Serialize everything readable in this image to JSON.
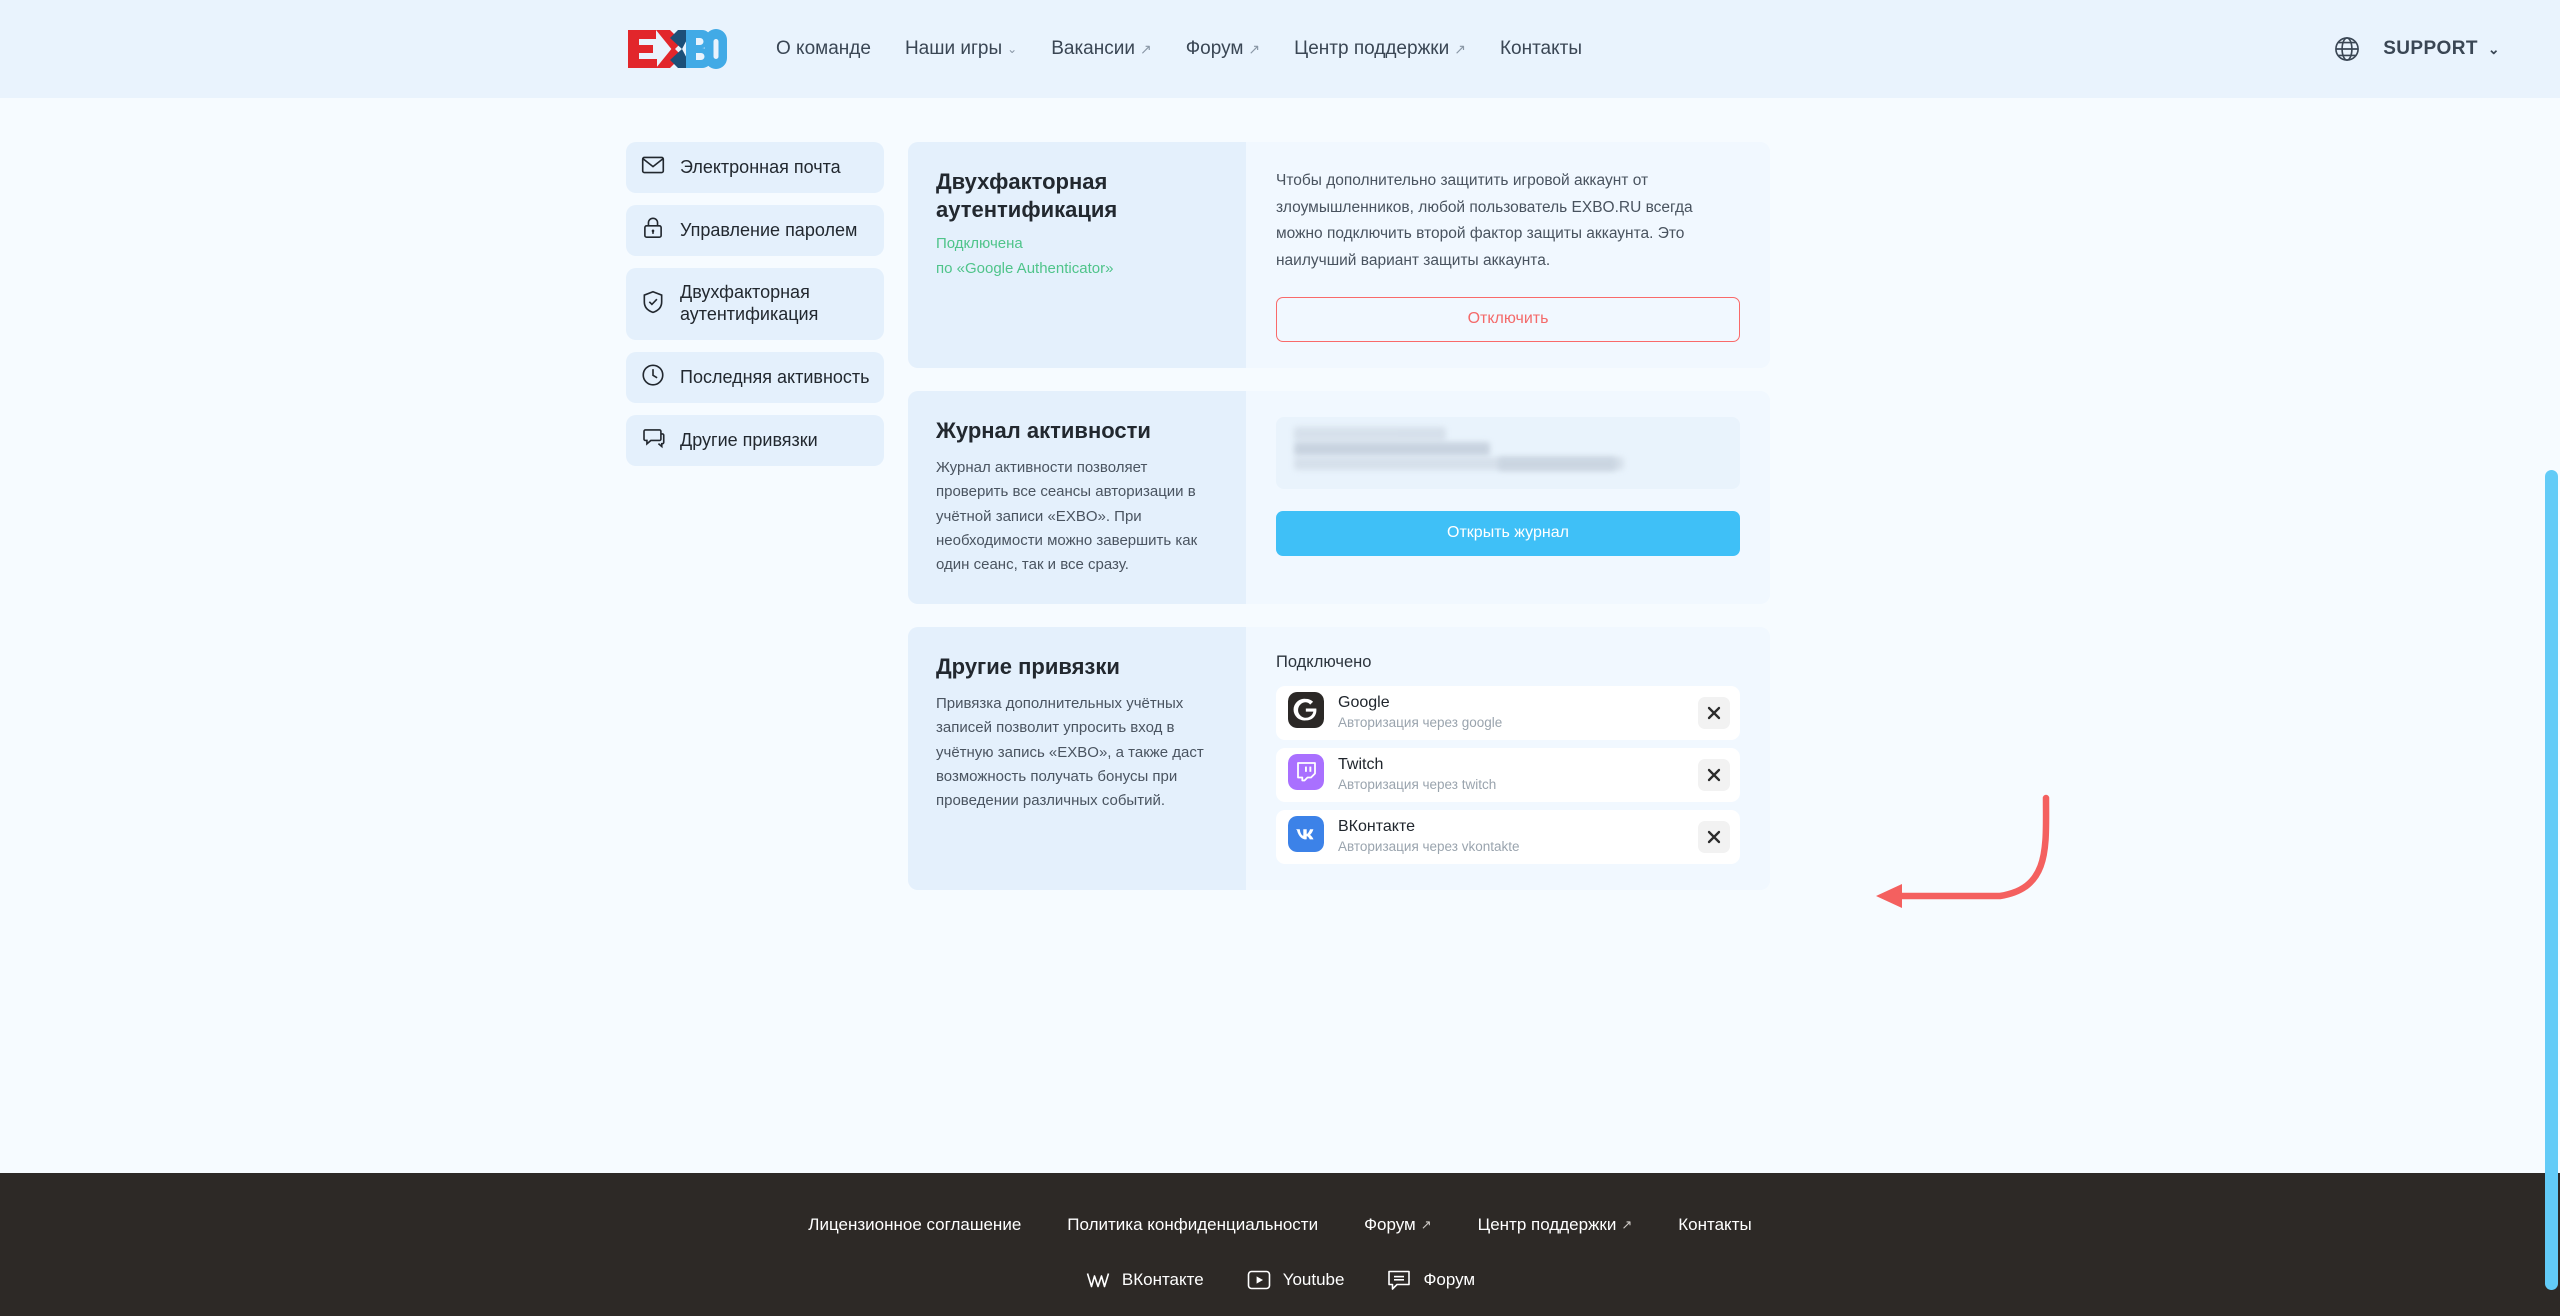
{
  "header": {
    "logo_text": "EXBO",
    "nav": [
      {
        "label": "О команде",
        "suffix": ""
      },
      {
        "label": "Наши игры",
        "suffix": "caret"
      },
      {
        "label": "Вакансии",
        "suffix": "ext"
      },
      {
        "label": "Форум",
        "suffix": "ext"
      },
      {
        "label": "Центр поддержки",
        "suffix": "ext"
      },
      {
        "label": "Контакты",
        "suffix": ""
      }
    ],
    "globe_icon": "globe-icon",
    "support_label": "SUPPORT",
    "support_caret": "⌄"
  },
  "sidebar": {
    "items": [
      {
        "label": "Электронная почта",
        "icon": "mail-icon"
      },
      {
        "label": "Управление паролем",
        "icon": "lock-icon"
      },
      {
        "label": "Двухфакторная аутентификация",
        "icon": "shield-check-icon"
      },
      {
        "label": "Последняя активность",
        "icon": "clock-icon"
      },
      {
        "label": "Другие привязки",
        "icon": "chat-icon"
      }
    ]
  },
  "cards": {
    "two_factor": {
      "title": "Двухфакторная аутентификация",
      "status": "Подключена",
      "method": "по «Google Authenticator»",
      "description": "Чтобы дополнительно защитить игровой аккаунт от злоумышленников, любой пользователь EXBO.RU всегда можно подключить второй фактор защиты аккаунта. Это наилучший вариант защиты аккаунта.",
      "button_label": "Отключить",
      "button_color": "#f46a6a"
    },
    "activity_log": {
      "title": "Журнал активности",
      "description": "Журнал активности позволяет проверить все сеансы авторизации в учётной записи «EXBO». При необходимости можно завершить как один сеанс, так и все сразу.",
      "session_preview": "(скрыто)",
      "button_label": "Открыть журнал",
      "button_color": "#3fc0f7"
    },
    "other_links": {
      "title": "Другие привязки",
      "description": "Привязка дополнительных учётных записей позволит упросить вход в учётную запись «EXBO», а также даст возможность получать бонусы при проведении различных событий.",
      "connected_label": "Подключено",
      "services": [
        {
          "name": "Google",
          "desc": "Авторизация через google",
          "icon": "google-icon",
          "color": "#2b2826",
          "remove_icon": "close-icon"
        },
        {
          "name": "Twitch",
          "desc": "Авторизация через twitch",
          "icon": "twitch-icon",
          "color": "#a970ff",
          "remove_icon": "close-icon"
        },
        {
          "name": "ВКонтакте",
          "desc": "Авторизация через vkontakte",
          "icon": "vk-icon",
          "color": "#3c82e8",
          "remove_icon": "close-icon"
        }
      ]
    }
  },
  "annotation": {
    "arrow_color": "#f4605f",
    "points_to": "google-remove-button"
  },
  "footer": {
    "links": [
      {
        "label": "Лицензионное соглашение",
        "suffix": ""
      },
      {
        "label": "Политика конфиденциальности",
        "suffix": ""
      },
      {
        "label": "Форум",
        "suffix": "ext"
      },
      {
        "label": "Центр поддержки",
        "suffix": "ext"
      },
      {
        "label": "Контакты",
        "suffix": ""
      }
    ],
    "socials": [
      {
        "label": "ВКонтакте",
        "icon": "vk-icon"
      },
      {
        "label": "Youtube",
        "icon": "youtube-icon"
      },
      {
        "label": "Форум",
        "icon": "forum-icon"
      }
    ]
  }
}
